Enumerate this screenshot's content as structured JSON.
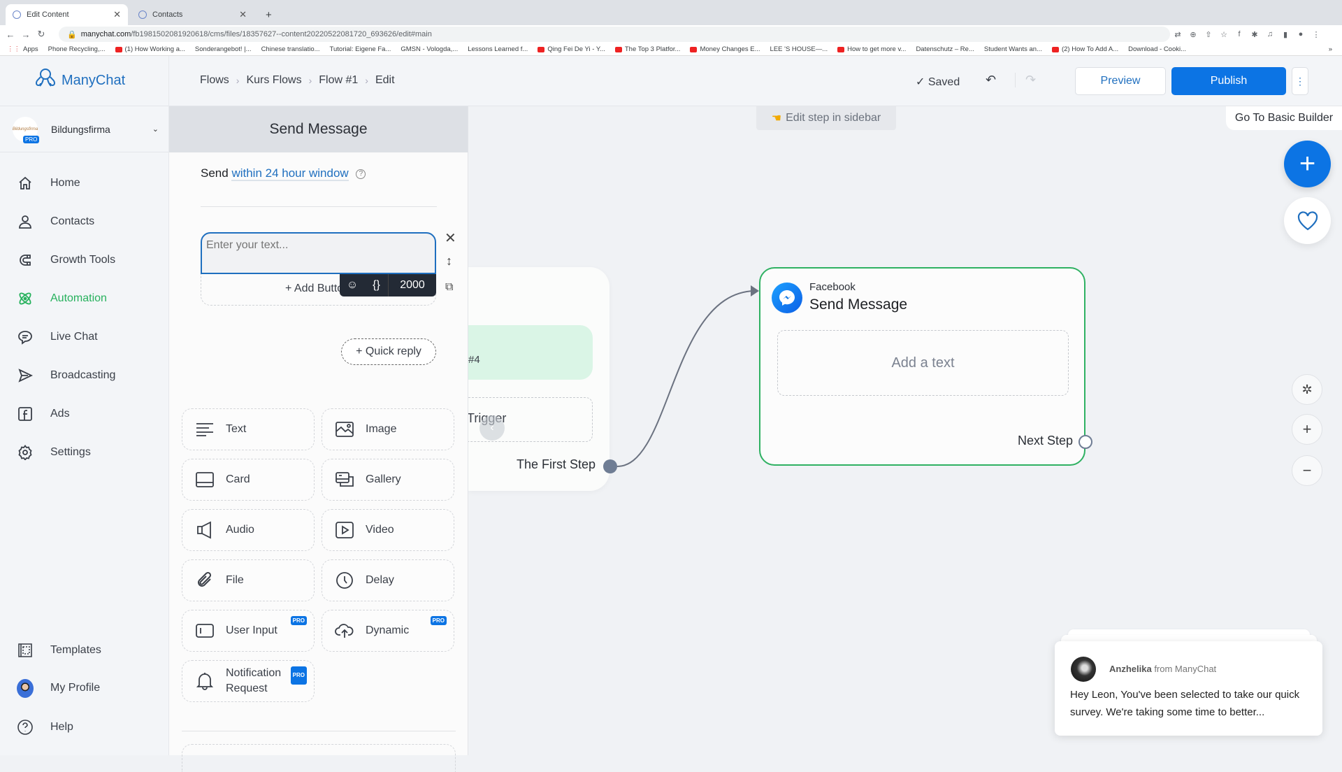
{
  "browser": {
    "tabs": [
      {
        "title": "Edit Content",
        "active": true
      },
      {
        "title": "Contacts",
        "active": false
      }
    ],
    "new_tab": "+",
    "url_domain": "manychat.com",
    "url_path": "/fb198150208192061​8/cms/files/18357627--content20220522081720_693626/edit#main",
    "bookmarks": [
      "Apps",
      "Phone Recycling,...",
      "(1) How Working a...",
      "Sonderangebot! |...",
      "Chinese translatio...",
      "Tutorial: Eigene Fa...",
      "GMSN - Vologda,...",
      "Lessons Learned f...",
      "Qing Fei De Yi - Y...",
      "The Top 3 Platfor...",
      "Money Changes E...",
      "LEE 'S HOUSE—...",
      "How to get more v...",
      "Datenschutz – Re...",
      "Student Wants an...",
      "(2) How To Add A...",
      "Download - Cooki..."
    ],
    "bookmarks_overflow": "»"
  },
  "sidebar": {
    "logo_text": "ManyChat",
    "account": {
      "name": "Bildungsfirma",
      "badge": "PRO",
      "avatar_text": "Bildungsfirma"
    },
    "items": [
      {
        "label": "Home",
        "icon": "home-icon",
        "active": false
      },
      {
        "label": "Contacts",
        "icon": "user-icon",
        "active": false
      },
      {
        "label": "Growth Tools",
        "icon": "magnet-icon",
        "active": false
      },
      {
        "label": "Automation",
        "icon": "atom-icon",
        "active": true
      },
      {
        "label": "Live Chat",
        "icon": "chat-bubble-icon",
        "active": false
      },
      {
        "label": "Broadcasting",
        "icon": "send-icon",
        "active": false
      },
      {
        "label": "Ads",
        "icon": "facebook-icon",
        "active": false
      },
      {
        "label": "Settings",
        "icon": "gear-icon",
        "active": false
      }
    ],
    "bottom_items": [
      {
        "label": "Templates",
        "icon": "templates-icon"
      },
      {
        "label": "My Profile",
        "icon": "avatar"
      },
      {
        "label": "Help",
        "icon": "help-icon"
      }
    ]
  },
  "header": {
    "breadcrumbs": [
      "Flows",
      "Kurs Flows",
      "Flow #1",
      "Edit"
    ],
    "saved_label": "✓ Saved",
    "preview_label": "Preview",
    "publish_label": "Publish",
    "more_label": "⋮"
  },
  "editor": {
    "title": "Send Message",
    "send_prefix": "Send",
    "send_window": "within 24 hour window",
    "help_glyph": "?",
    "text_placeholder": "Enter your text...",
    "add_button_label": "+ Add Button",
    "char_limit": "2000",
    "quick_reply_label": "+ Quick reply",
    "blocks": [
      {
        "label": "Text",
        "icon": "text-lines-icon",
        "pro": false
      },
      {
        "label": "Image",
        "icon": "image-icon",
        "pro": false
      },
      {
        "label": "Card",
        "icon": "card-icon",
        "pro": false
      },
      {
        "label": "Gallery",
        "icon": "gallery-icon",
        "pro": false
      },
      {
        "label": "Audio",
        "icon": "speaker-icon",
        "pro": false
      },
      {
        "label": "Video",
        "icon": "video-icon",
        "pro": false
      },
      {
        "label": "File",
        "icon": "paperclip-icon",
        "pro": false
      },
      {
        "label": "Delay",
        "icon": "clock-icon",
        "pro": false
      },
      {
        "label": "User Input",
        "icon": "input-icon",
        "pro": true
      },
      {
        "label": "Dynamic",
        "icon": "cloud-upload-icon",
        "pro": true
      },
      {
        "label": "Notification Request",
        "icon": "bell-icon",
        "pro": true
      }
    ],
    "pro_badge": "PRO"
  },
  "canvas": {
    "hint": "Edit step in sidebar",
    "basic_builder_label": "Go To Basic Builder",
    "start_node": {
      "label_partial": "#4",
      "trigger_partial": "Trigger",
      "first_step_label": "The First Step"
    },
    "message_node": {
      "platform": "Facebook",
      "title": "Send Message",
      "placeholder": "Add a text",
      "next_step_label": "Next Step"
    }
  },
  "chat_popup": {
    "sender": "Anzhelika",
    "from_suffix": "from ManyChat",
    "message": "Hey Leon,  You've been selected to take our quick survey. We're taking some time to better..."
  },
  "colors": {
    "accent_blue": "#0c74e4",
    "link_blue": "#1f6fbf",
    "active_green": "#27b15d",
    "node_border_green": "#2fb162"
  }
}
